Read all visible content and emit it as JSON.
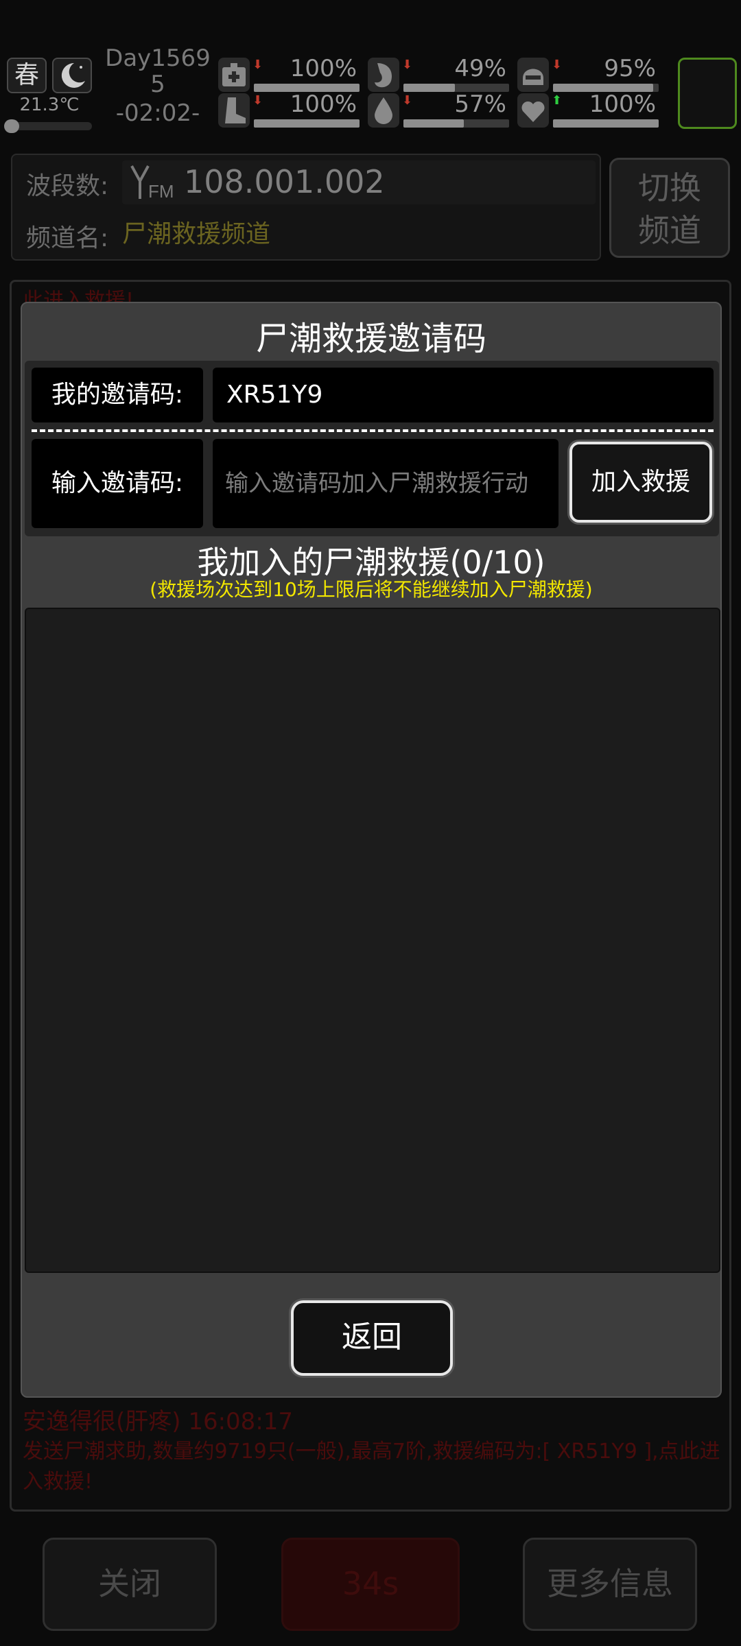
{
  "status": {
    "season": "春",
    "temperature": "21.3℃",
    "day": "Day1569",
    "day_tail": "5",
    "clock": "-02:02-",
    "stats": [
      {
        "name": "health",
        "icon": "medkit-icon",
        "value_text": "100%",
        "level": 1.0,
        "trend": "down"
      },
      {
        "name": "hunger",
        "icon": "stomach-icon",
        "value_text": "49%",
        "level": 0.49,
        "trend": "down"
      },
      {
        "name": "armor",
        "icon": "helmet-icon",
        "value_text": "95%",
        "level": 0.95,
        "trend": "down"
      },
      {
        "name": "stamina",
        "icon": "boot-icon",
        "value_text": "100%",
        "level": 1.0,
        "trend": "down"
      },
      {
        "name": "water",
        "icon": "water-drop-icon",
        "value_text": "57%",
        "level": 0.57,
        "trend": "down"
      },
      {
        "name": "mood",
        "icon": "heart-icon",
        "value_text": "100%",
        "level": 1.0,
        "trend": "up"
      }
    ],
    "trend_colors": {
      "down": "#c0392b",
      "up": "#2ecc40"
    }
  },
  "radio": {
    "band_label": "波段数:",
    "frequency": "108.001.002",
    "fm_icon": "FM",
    "channel_label": "频道名:",
    "channel_name": "尸潮救援频道",
    "switch_button": "切换\n频道"
  },
  "chat": {
    "top_line": "此进入救援!",
    "sender": "安逸得很(肝疼)   16:08:17",
    "message": "发送尸潮求助,数量约9719只(一般),最高7阶,救援编码为:[ XR51Y9 ],点此进入救援!"
  },
  "modal": {
    "title": "尸潮救援邀请码",
    "my_code_label": "我的邀请码:",
    "my_code": "XR51Y9",
    "input_label": "输入邀请码:",
    "input_placeholder": "输入邀请码加入尸潮救援行动",
    "join_button": "加入救援",
    "list_title": "我加入的尸潮救援(0/10)",
    "list_note": "(救援场次达到10场上限后将不能继续加入尸潮救援)",
    "back_button": "返回"
  },
  "bottom": {
    "close_button": "关闭",
    "timer": "34s",
    "more_button": "更多信息"
  },
  "colors": {
    "accent_yellow": "#f2e600",
    "minimap_border": "#4e8a1e"
  }
}
